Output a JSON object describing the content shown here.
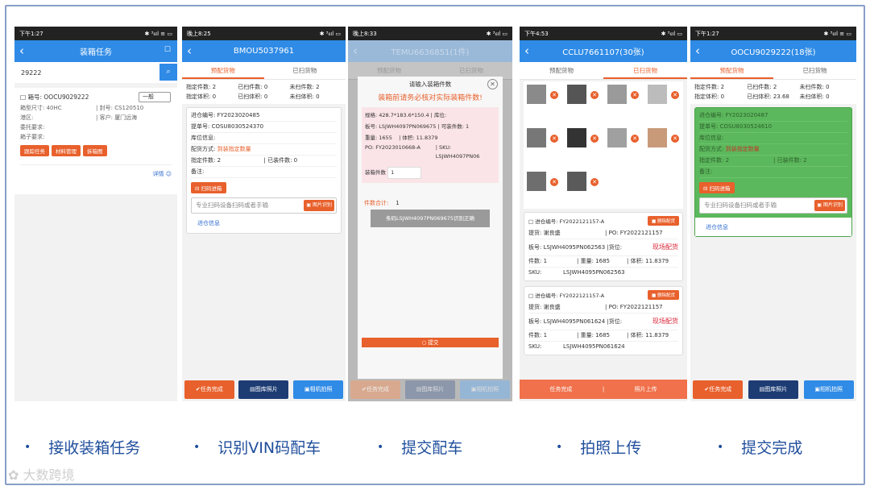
{
  "phones": {
    "p1": {
      "status_time": "下午1:27",
      "status_right": "✱ ³₆ıl ≡ ▭",
      "title": "装箱任务",
      "search_value": "29222",
      "box_label": "箱号:",
      "box_no": "OOCU9029222",
      "select_value": "一般",
      "size_label": "箱型尺寸:",
      "size": "40HC",
      "seal_label": "封号:",
      "seal": "CS120510",
      "port_label": "港区:",
      "customer_label": "客户:",
      "customer": "厦门远海",
      "consign_label": "委托要求:",
      "box_req_label": "箱子要求:",
      "btn1": "跟踪任务",
      "btn2": "材料管理",
      "btn3": "拆箱图",
      "detail": "详情"
    },
    "p2": {
      "status_time": "晚上8:25",
      "status_right": "✱ ³₆ıl ▭",
      "title": "BMOU5037961",
      "tab1": "预配货物",
      "tab2": "已扫货物",
      "s1": "指定件数: 2",
      "s2": "已扫件数: 0",
      "s3": "未扫件数: 2",
      "s4": "指定体积: 0",
      "s5": "已扫体积: 0",
      "s6": "未扫体积: 0",
      "r1": "进仓编号: FY2023020485",
      "r2": "提单号: COSU8030524370",
      "r3": "库位信息:",
      "r4_label": "配货方式:",
      "r4_value": "到装指定数量",
      "r5a": "指定件数: 2",
      "r5b": "已装件数: 0",
      "r6": "备注:",
      "scan_btn": "扫码进箱",
      "input_placeholder": "专业扫码设备扫码或者手输",
      "pic_btn": "图片识别",
      "link": "进仓信息",
      "bottom1": "任务完成",
      "bottom2": "图库照片",
      "bottom3": "相机拍照"
    },
    "p3": {
      "status_time": "晚上8:33",
      "status_right": "✱ ³₆ıl ▭",
      "title_faded": "TEMU6636851(1件)",
      "tab1": "预配货物",
      "tab2": "已扫货物",
      "modal_title": "请输入装箱件数",
      "warning": "装箱前请务必核对实际装箱件数!",
      "spec_label": "规格:",
      "spec": "428.7*183.6*150.4",
      "loc_label": "库位:",
      "board_label": "板号:",
      "board": "LSJWH4097PN069675",
      "avail_label": "可装件数:",
      "avail": "1",
      "weight_label": "重量:",
      "weight": "1655",
      "vol_label": "体积:",
      "vol": "11.8379",
      "po_label": "PO:",
      "po": "FY2023010668-A",
      "sku_label": "SKU:",
      "sku": "LSJWH4097PN06",
      "qty_label": "装箱件数",
      "qty": "1",
      "total_label": "件数合计:",
      "total": "1",
      "grey_btn": "条码LSJWH4097PN069675识别正确",
      "submit": "提交",
      "bottom1": "任务完成",
      "bottom2": "图库照片",
      "bottom3": "相机拍照"
    },
    "p4": {
      "status_time": "下午4:53",
      "status_right": "✱ ³₆ıl ▭",
      "title": "CCLU7661107(30张)",
      "tab1": "预配货物",
      "tab2": "已扫货物",
      "card1": {
        "no": "进仓编号: FY2022121157-A",
        "del": "删除配货",
        "ship_label": "提货:",
        "ship": "谢良盛",
        "po": "PO: FY2022121157",
        "board_label": "板号:",
        "board": "LSJWH4095PN062563",
        "loc_label": "货位:",
        "status": "现场配货",
        "pieces": "件数: 1",
        "weight": "重量: 1685",
        "vol": "体积: 11.8379",
        "sku_label": "SKU:",
        "sku": "LSJWH4095PN062563"
      },
      "card2": {
        "no": "进仓编号: FY2022121157-A",
        "del": "删除配货",
        "ship_label": "提货:",
        "ship": "谢良盛",
        "po": "PO: FY2022121157",
        "board_label": "板号:",
        "board": "LSJWH4095PN061624",
        "loc_label": "货位:",
        "status": "现场配货",
        "pieces": "件数: 1",
        "weight": "重量: 1685",
        "vol": "体积: 11.8379",
        "sku_label": "SKU:",
        "sku": "LSJWH4095PN061624"
      },
      "bottom1": "任务完成",
      "bottom2": "照片上传"
    },
    "p5": {
      "status_time": "下午1:27",
      "status_right": "✱ ³₆ıl ≡ ▭",
      "title": "OOCU9029222(18张)",
      "tab1": "预配货物",
      "tab2": "已扫货物",
      "s1": "指定件数: 2",
      "s2": "已扫件数: 2",
      "s3": "未扫件数: 0",
      "s4": "指定体积: 0",
      "s5": "已扫体积: 23.68",
      "s6": "未扫体积: 0",
      "r1": "进仓编号: FY2023020487",
      "r2": "提单号: COSU8030524610",
      "r3": "库位信息:",
      "r4_label": "配货方式:",
      "r4_value": "到装指定数量",
      "r5a": "指定件数: 2",
      "r5b": "已装件数: 2",
      "r6": "备注:",
      "scan_btn": "扫码进箱",
      "input_placeholder": "专业扫码设备扫码或者手输",
      "pic_btn": "图片识别",
      "link": "进仓信息",
      "bottom1": "任务完成",
      "bottom2": "图库照片",
      "bottom3": "相机拍照"
    }
  },
  "captions": [
    "接收装箱任务",
    "识别VIN码配车",
    "提交配车",
    "拍照上传",
    "提交完成"
  ],
  "watermark": "大数跨境",
  "colors": {
    "accent_blue": "#2f8be6",
    "accent_orange": "#e8602c",
    "done_green": "#5cb85c",
    "caption_blue": "#1f4e9c"
  }
}
